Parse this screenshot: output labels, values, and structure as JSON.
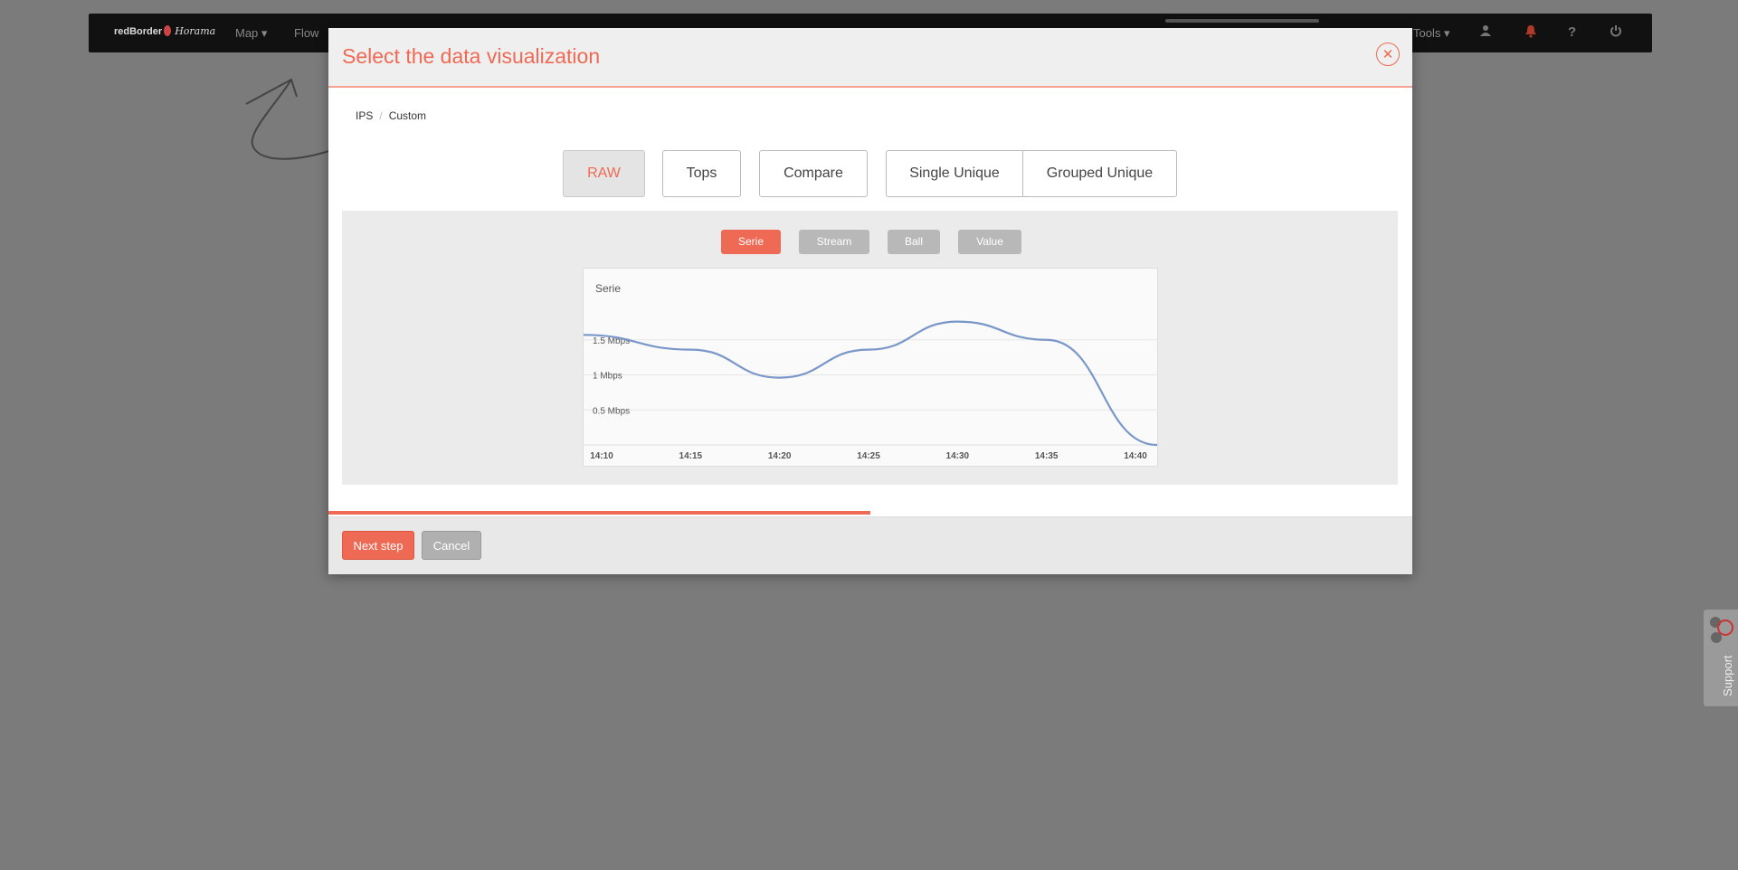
{
  "navbar": {
    "brand_name": "redBorder",
    "brand_product": "Horama",
    "items": [
      "Map",
      "Flow"
    ],
    "tools_label": "Tools"
  },
  "modal": {
    "title": "Select the data visualization",
    "close_icon": "close-icon",
    "breadcrumb": [
      "IPS",
      "Custom"
    ],
    "visualization_types": [
      "RAW",
      "Tops",
      "Compare",
      "Single Unique",
      "Grouped Unique"
    ],
    "active_type": "RAW",
    "subtypes": [
      "Serie",
      "Stream",
      "Ball",
      "Value"
    ],
    "active_subtype": "Serie",
    "progress_fraction": 0.5,
    "next_label": "Next step",
    "cancel_label": "Cancel"
  },
  "chart_data": {
    "type": "line",
    "title": "Serie",
    "x": [
      "14:10",
      "14:15",
      "14:20",
      "14:25",
      "14:30",
      "14:35",
      "14:40"
    ],
    "x_ticks": [
      "14:10",
      "14:15",
      "14:20",
      "14:25",
      "14:30",
      "14:35",
      "14:40"
    ],
    "y_ticks": [
      "0.5 Mbps",
      "1 Mbps",
      "1.5 Mbps"
    ],
    "y_tick_values": [
      0.5,
      1,
      1.5
    ],
    "values": [
      1.57,
      1.36,
      0.96,
      1.36,
      1.76,
      1.5,
      0.0
    ],
    "ylim": [
      0,
      2
    ],
    "grid": true,
    "line_color": "#7a97c9"
  },
  "support": {
    "label": "Support"
  }
}
